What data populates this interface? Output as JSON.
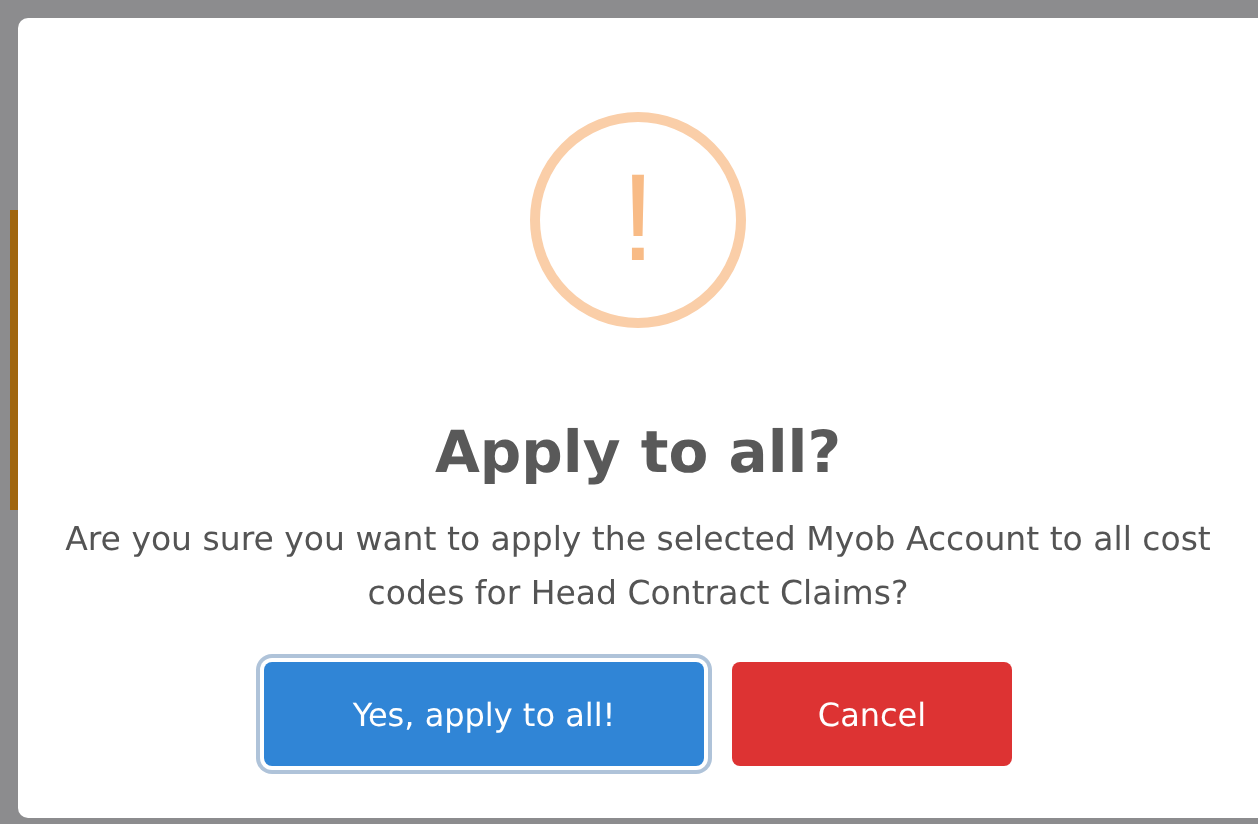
{
  "dialog": {
    "icon": "!",
    "title": "Apply to all?",
    "message": "Are you sure you want to apply the selected Myob Account to all cost codes for Head Contract Claims?",
    "buttons": [
      {
        "label": "Yes, apply to all!",
        "kind": "confirm",
        "focused": true
      },
      {
        "label": "Cancel",
        "kind": "cancel",
        "focused": false
      }
    ]
  }
}
